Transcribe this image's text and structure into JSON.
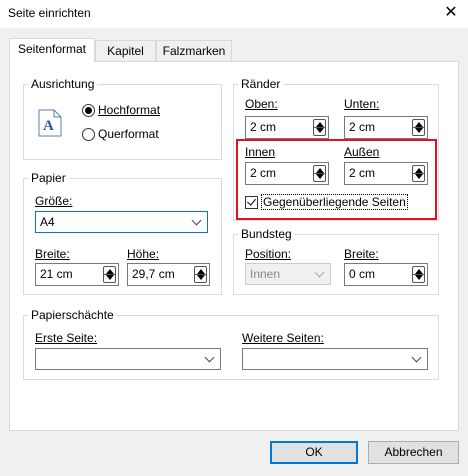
{
  "window": {
    "title": "Seite einrichten",
    "close_glyph": "✕"
  },
  "tabs": [
    "Seitenformat",
    "Kapitel",
    "Falzmarken"
  ],
  "orientation": {
    "legend": "Ausrichtung",
    "portrait": "Hochformat",
    "landscape": "Querformat",
    "selected": "Hochformat",
    "icon_glyph": "A"
  },
  "paper": {
    "legend": "Papier",
    "size_label": "Größe:",
    "size_value": "A4",
    "width_label": "Breite:",
    "width_value": "21 cm",
    "height_label": "Höhe:",
    "height_value": "29,7 cm"
  },
  "margins": {
    "legend": "Ränder",
    "top_label": "Oben:",
    "top_value": "2 cm",
    "bottom_label": "Unten:",
    "bottom_value": "2 cm",
    "inner_label": "Innen",
    "inner_value": "2 cm",
    "outer_label": "Außen",
    "outer_value": "2 cm",
    "facing_label": "Gegenüberliegende Seiten",
    "facing_checked": true
  },
  "gutter": {
    "legend": "Bundsteg",
    "position_label": "Position:",
    "position_value": "Innen",
    "width_label": "Breite:",
    "width_value": "0 cm"
  },
  "trays": {
    "legend": "Papierschächte",
    "first_label": "Erste Seite:",
    "first_value": "",
    "other_label": "Weitere Seiten:",
    "other_value": ""
  },
  "buttons": {
    "ok": "OK",
    "cancel": "Abbrechen"
  },
  "colors": {
    "highlight": "#e0141e",
    "focus": "#0078d7"
  }
}
